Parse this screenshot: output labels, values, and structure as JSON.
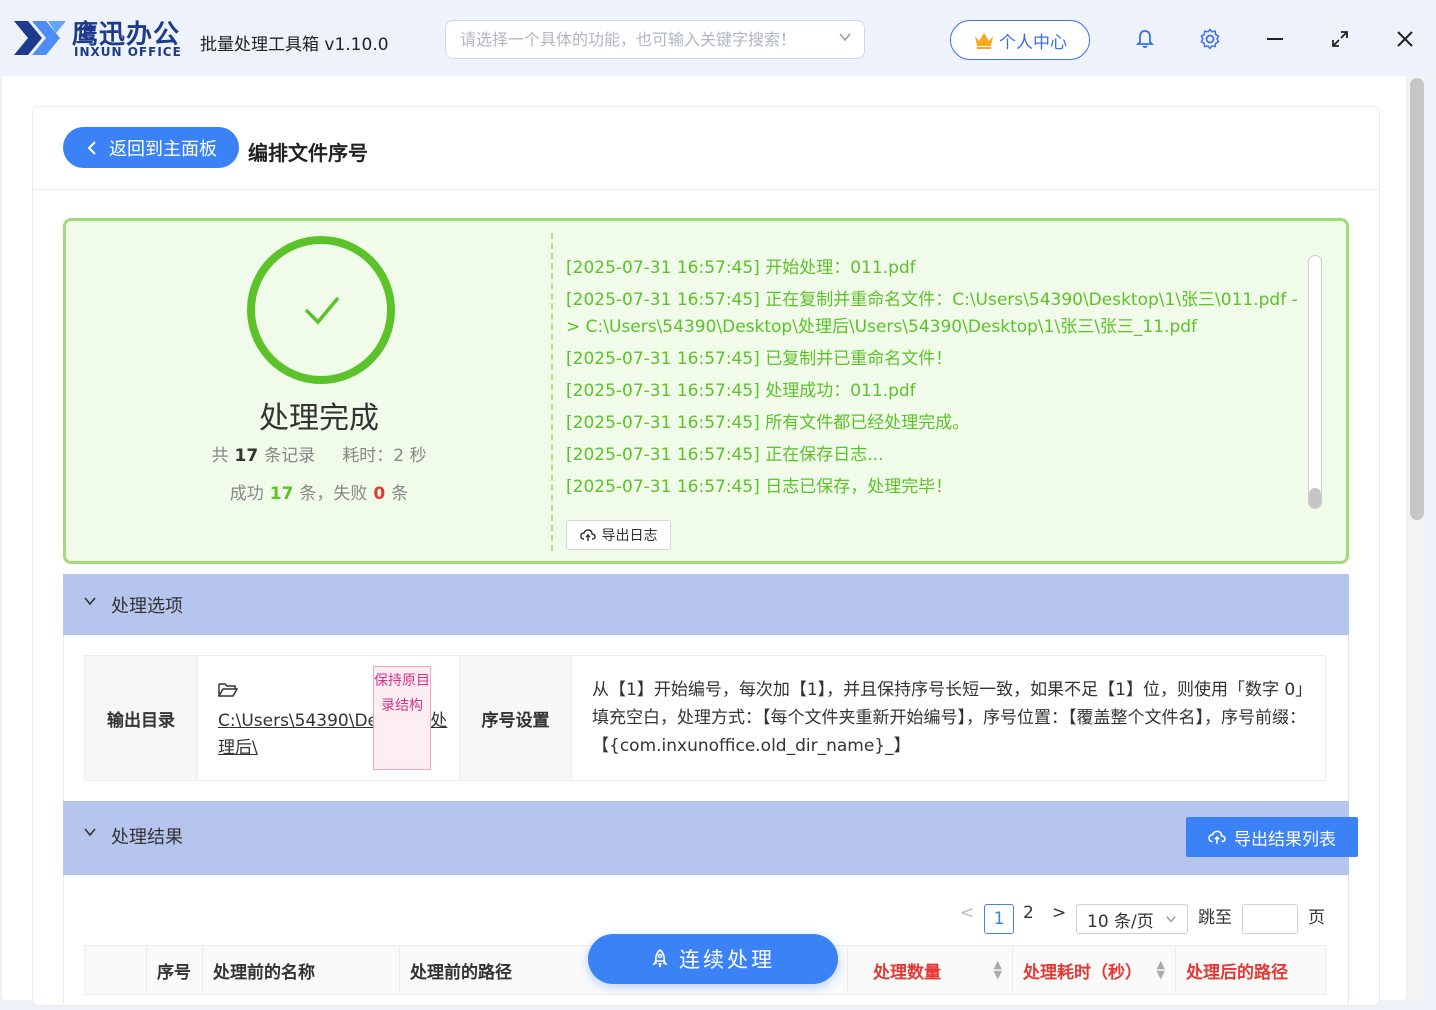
{
  "titlebar": {
    "brand_cn": "鹰迅办公",
    "brand_en": "INXUN OFFICE",
    "app_title": "批量处理工具箱 v1.10.0",
    "search_placeholder": "请选择一个具体的功能，也可输入关键字搜索！",
    "user_center": "个人中心",
    "colors": {
      "accent": "#3b6ef5",
      "logo_dark": "#1e3a8a"
    }
  },
  "header": {
    "back_label": "返回到主面板",
    "page_title": "编排文件序号"
  },
  "status": {
    "title": "处理完成",
    "total_prefix": "共",
    "total_count": "17",
    "total_suffix": "条记录",
    "time_label": "耗时：2 秒",
    "success_prefix": "成功",
    "success_count": "17",
    "success_suffix": "条，失败",
    "fail_count": "0",
    "fail_suffix": "条",
    "log_lines": [
      "[2025-07-31 16:57:45] 开始处理：011.pdf",
      "[2025-07-31 16:57:45] 正在复制并重命名文件：C:\\Users\\54390\\Desktop\\1\\张三\\011.pdf -> C:\\Users\\54390\\Desktop\\处理后\\Users\\54390\\Desktop\\1\\张三\\张三_11.pdf",
      "[2025-07-31 16:57:45] 已复制并已重命名文件！",
      "[2025-07-31 16:57:45] 处理成功：011.pdf",
      "[2025-07-31 16:57:45] 所有文件都已经处理完成。",
      "[2025-07-31 16:57:45] 正在保存日志...",
      "[2025-07-31 16:57:45] 日志已保存，处理完毕！"
    ],
    "export_log": "导出日志",
    "colors": {
      "success": "#5cc22a",
      "fail": "#e53935",
      "box_bg": "#f1fbe9"
    }
  },
  "options": {
    "section_label": "处理选项",
    "output_dir_key": "输出目录",
    "output_dir_value": "C:\\Users\\54390\\Desktop\\处理后\\",
    "keep_structure_tag": "保持原目录结构",
    "seq_key": "序号设置",
    "seq_desc": "从【1】开始编号，每次加【1】，并且保持序号长短一致，如果不足【1】位，则使用「数字 0」填充空白，处理方式：【每个文件夹重新开始编号】，序号位置：【覆盖整个文件名】，序号前缀：【{com.inxunoffice.old_dir_name}_】"
  },
  "results": {
    "section_label": "处理结果",
    "export_btn": "导出结果列表",
    "pager": {
      "pages": [
        "1",
        "2"
      ],
      "current": "1",
      "page_size": "10 条/页",
      "jump_label": "跳至",
      "page_unit": "页"
    },
    "columns": [
      "序号",
      "处理前的名称",
      "处理前的路径",
      "处理数量",
      "处理耗时（秒）",
      "处理后的路径"
    ]
  },
  "continue_btn": "连续处理"
}
